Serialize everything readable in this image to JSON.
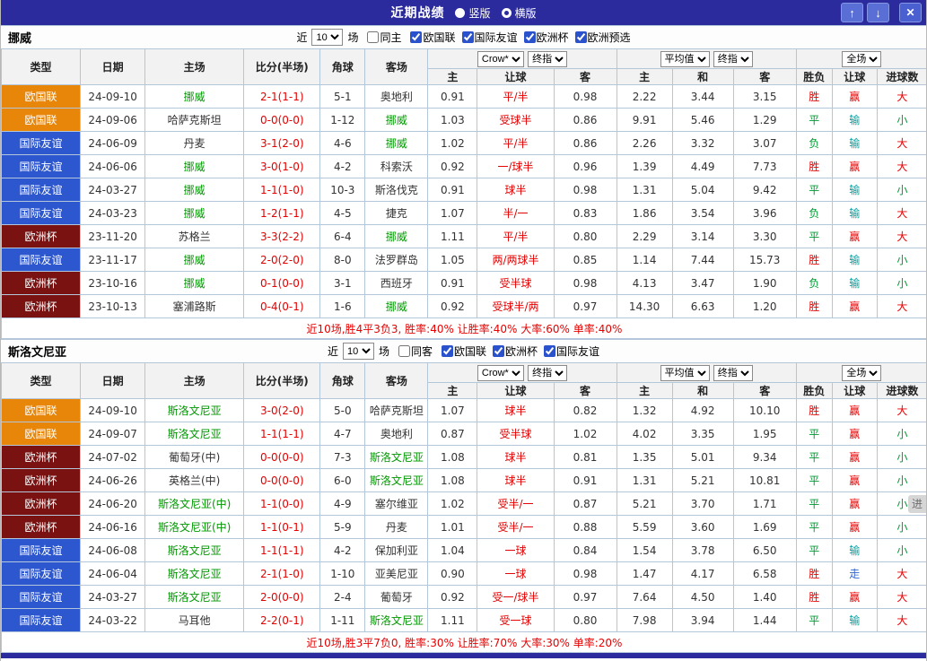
{
  "titlebar": {
    "title": "近期战绩",
    "vertical_label": "竖版",
    "horizontal_label": "横版",
    "vertical_selected": false,
    "horizontal_selected": true,
    "up_icon": "↑",
    "down_icon": "↓",
    "close_icon": "✕"
  },
  "table_header": {
    "cols": [
      "类型",
      "日期",
      "主场",
      "比分(半场)",
      "角球",
      "客场"
    ],
    "group1": {
      "select1": "Crow*",
      "select2": "终指",
      "sub": [
        "主",
        "让球",
        "客"
      ]
    },
    "group2": {
      "select1": "平均值",
      "select2": "终指",
      "sub": [
        "主",
        "和",
        "客"
      ]
    },
    "group3": {
      "select": "全场",
      "sub": [
        "胜负",
        "让球",
        "进球数"
      ]
    }
  },
  "maps": {
    "type_colors": {
      "欧国联": "#e8860a",
      "国际友谊": "#2d57cf",
      "欧洲杯": "#7a1212"
    },
    "result_colors": {
      "胜": "#e60000",
      "平": "#009933",
      "负": "#009933",
      "赢": "#e60000",
      "输": "#00a0a0",
      "走": "#3366cc",
      "大": "#e60000",
      "小": "#009933"
    },
    "accent_navy": "#2b2b9e",
    "grid_border": "#b3c6da"
  },
  "sections": [
    {
      "team": "挪威",
      "filter": {
        "recent_label": "近",
        "count": "10",
        "games_label": "场",
        "same_label": "同主",
        "same_checked": false,
        "comps": [
          {
            "label": "欧国联",
            "checked": true
          },
          {
            "label": "国际友谊",
            "checked": true
          },
          {
            "label": "欧洲杯",
            "checked": true
          },
          {
            "label": "欧洲预选",
            "checked": true
          }
        ]
      },
      "rows": [
        [
          "欧国联",
          "24-09-10",
          "挪威",
          1,
          "2-1(1-1)",
          "5-1",
          "奥地利",
          0,
          "0.91",
          "平/半",
          "0.98",
          "2.22",
          "3.44",
          "3.15",
          "胜",
          "赢",
          "大"
        ],
        [
          "欧国联",
          "24-09-06",
          "哈萨克斯坦",
          0,
          "0-0(0-0)",
          "1-12",
          "挪威",
          1,
          "1.03",
          "受球半",
          "0.86",
          "9.91",
          "5.46",
          "1.29",
          "平",
          "输",
          "小"
        ],
        [
          "国际友谊",
          "24-06-09",
          "丹麦",
          0,
          "3-1(2-0)",
          "4-6",
          "挪威",
          1,
          "1.02",
          "平/半",
          "0.86",
          "2.26",
          "3.32",
          "3.07",
          "负",
          "输",
          "大"
        ],
        [
          "国际友谊",
          "24-06-06",
          "挪威",
          1,
          "3-0(1-0)",
          "4-2",
          "科索沃",
          0,
          "0.92",
          "一/球半",
          "0.96",
          "1.39",
          "4.49",
          "7.73",
          "胜",
          "赢",
          "大"
        ],
        [
          "国际友谊",
          "24-03-27",
          "挪威",
          1,
          "1-1(1-0)",
          "10-3",
          "斯洛伐克",
          0,
          "0.91",
          "球半",
          "0.98",
          "1.31",
          "5.04",
          "9.42",
          "平",
          "输",
          "小"
        ],
        [
          "国际友谊",
          "24-03-23",
          "挪威",
          1,
          "1-2(1-1)",
          "4-5",
          "捷克",
          0,
          "1.07",
          "半/一",
          "0.83",
          "1.86",
          "3.54",
          "3.96",
          "负",
          "输",
          "大"
        ],
        [
          "欧洲杯",
          "23-11-20",
          "苏格兰",
          0,
          "3-3(2-2)",
          "6-4",
          "挪威",
          1,
          "1.11",
          "平/半",
          "0.80",
          "2.29",
          "3.14",
          "3.30",
          "平",
          "赢",
          "大"
        ],
        [
          "国际友谊",
          "23-11-17",
          "挪威",
          1,
          "2-0(2-0)",
          "8-0",
          "法罗群岛",
          0,
          "1.05",
          "两/两球半",
          "0.85",
          "1.14",
          "7.44",
          "15.73",
          "胜",
          "输",
          "小"
        ],
        [
          "欧洲杯",
          "23-10-16",
          "挪威",
          1,
          "0-1(0-0)",
          "3-1",
          "西班牙",
          0,
          "0.91",
          "受半球",
          "0.98",
          "4.13",
          "3.47",
          "1.90",
          "负",
          "输",
          "小"
        ],
        [
          "欧洲杯",
          "23-10-13",
          "塞浦路斯",
          0,
          "0-4(0-1)",
          "1-6",
          "挪威",
          1,
          "0.92",
          "受球半/两",
          "0.97",
          "14.30",
          "6.63",
          "1.20",
          "胜",
          "赢",
          "大"
        ]
      ],
      "summary": "近10场,胜4平3负3, 胜率:40% 让胜率:40% 大率:60% 单率:40%"
    },
    {
      "team": "斯洛文尼亚",
      "filter": {
        "recent_label": "近",
        "count": "10",
        "games_label": "场",
        "same_label": "同客",
        "same_checked": false,
        "comps": [
          {
            "label": "欧国联",
            "checked": true
          },
          {
            "label": "欧洲杯",
            "checked": true
          },
          {
            "label": "国际友谊",
            "checked": true
          }
        ]
      },
      "rows": [
        [
          "欧国联",
          "24-09-10",
          "斯洛文尼亚",
          1,
          "3-0(2-0)",
          "5-0",
          "哈萨克斯坦",
          0,
          "1.07",
          "球半",
          "0.82",
          "1.32",
          "4.92",
          "10.10",
          "胜",
          "赢",
          "大"
        ],
        [
          "欧国联",
          "24-09-07",
          "斯洛文尼亚",
          1,
          "1-1(1-1)",
          "4-7",
          "奥地利",
          0,
          "0.87",
          "受半球",
          "1.02",
          "4.02",
          "3.35",
          "1.95",
          "平",
          "赢",
          "小"
        ],
        [
          "欧洲杯",
          "24-07-02",
          "葡萄牙(中)",
          0,
          "0-0(0-0)",
          "7-3",
          "斯洛文尼亚",
          1,
          "1.08",
          "球半",
          "0.81",
          "1.35",
          "5.01",
          "9.34",
          "平",
          "赢",
          "小"
        ],
        [
          "欧洲杯",
          "24-06-26",
          "英格兰(中)",
          0,
          "0-0(0-0)",
          "6-0",
          "斯洛文尼亚",
          1,
          "1.08",
          "球半",
          "0.91",
          "1.31",
          "5.21",
          "10.81",
          "平",
          "赢",
          "小"
        ],
        [
          "欧洲杯",
          "24-06-20",
          "斯洛文尼亚(中)",
          1,
          "1-1(0-0)",
          "4-9",
          "塞尔维亚",
          0,
          "1.02",
          "受半/一",
          "0.87",
          "5.21",
          "3.70",
          "1.71",
          "平",
          "赢",
          "小"
        ],
        [
          "欧洲杯",
          "24-06-16",
          "斯洛文尼亚(中)",
          1,
          "1-1(0-1)",
          "5-9",
          "丹麦",
          0,
          "1.01",
          "受半/一",
          "0.88",
          "5.59",
          "3.60",
          "1.69",
          "平",
          "赢",
          "小"
        ],
        [
          "国际友谊",
          "24-06-08",
          "斯洛文尼亚",
          1,
          "1-1(1-1)",
          "4-2",
          "保加利亚",
          0,
          "1.04",
          "一球",
          "0.84",
          "1.54",
          "3.78",
          "6.50",
          "平",
          "输",
          "小"
        ],
        [
          "国际友谊",
          "24-06-04",
          "斯洛文尼亚",
          1,
          "2-1(1-0)",
          "1-10",
          "亚美尼亚",
          0,
          "0.90",
          "一球",
          "0.98",
          "1.47",
          "4.17",
          "6.58",
          "胜",
          "走",
          "大"
        ],
        [
          "国际友谊",
          "24-03-27",
          "斯洛文尼亚",
          1,
          "2-0(0-0)",
          "2-4",
          "葡萄牙",
          0,
          "0.92",
          "受一/球半",
          "0.97",
          "7.64",
          "4.50",
          "1.40",
          "胜",
          "赢",
          "大"
        ],
        [
          "国际友谊",
          "24-03-22",
          "马耳他",
          0,
          "2-2(0-1)",
          "1-11",
          "斯洛文尼亚",
          1,
          "1.11",
          "受一球",
          "0.80",
          "7.98",
          "3.94",
          "1.44",
          "平",
          "输",
          "大"
        ]
      ],
      "summary": "近10场,胜3平7负0, 胜率:30% 让胜率:70% 大率:30% 单率:20%"
    }
  ],
  "floating_hint": "进"
}
